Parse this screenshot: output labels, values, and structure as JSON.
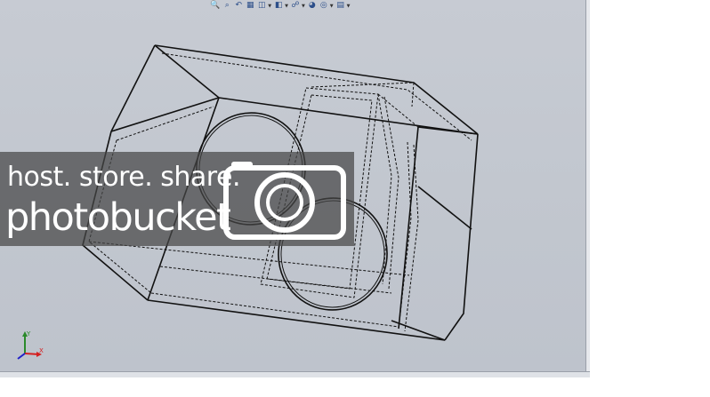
{
  "toolbar": {
    "items": [
      {
        "icon": "zoom-to-fit-icon",
        "glyph": "🔍",
        "has_menu": false
      },
      {
        "icon": "zoom-to-area-icon",
        "glyph": "⌕",
        "has_menu": false
      },
      {
        "icon": "previous-view-icon",
        "glyph": "↶",
        "has_menu": false
      },
      {
        "icon": "section-view-icon",
        "glyph": "▦",
        "has_menu": false
      },
      {
        "icon": "view-orientation-icon",
        "glyph": "◫",
        "has_menu": true
      },
      {
        "icon": "display-style-icon",
        "glyph": "◧",
        "has_menu": true
      },
      {
        "icon": "hide-show-items-icon",
        "glyph": "☍",
        "has_menu": true
      },
      {
        "icon": "edit-appearance-icon",
        "glyph": "◕",
        "has_menu": false
      },
      {
        "icon": "apply-scene-icon",
        "glyph": "◎",
        "has_menu": true
      },
      {
        "icon": "view-settings-icon",
        "glyph": "▤",
        "has_menu": true
      }
    ]
  },
  "triad": {
    "x_label": "X",
    "y_label": "Y",
    "x_color": "#d42020",
    "y_color": "#2a8a2a",
    "z_color": "#2020c8"
  },
  "watermark": {
    "line1": "host. store. share.",
    "line2": "photobucket",
    "color": "#ffffff"
  },
  "colors": {
    "viewport_bg": "#c4c8d0",
    "model_edge": "#111111"
  }
}
